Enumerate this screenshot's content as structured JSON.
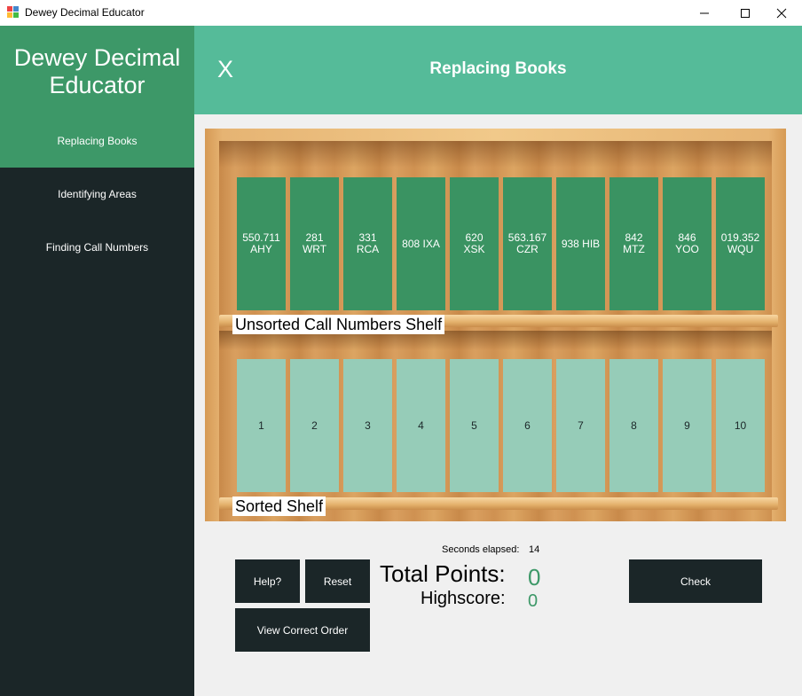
{
  "window": {
    "title": "Dewey Decimal Educator"
  },
  "sidebar": {
    "brand": "Dewey Decimal Educator",
    "items": [
      {
        "label": "Replacing Books",
        "active": true
      },
      {
        "label": "Identifying Areas",
        "active": false
      },
      {
        "label": "Finding Call Numbers",
        "active": false
      }
    ]
  },
  "header": {
    "close_label": "X",
    "title": "Replacing Books"
  },
  "unsorted_shelf": {
    "label": "Unsorted Call Numbers Shelf",
    "books": [
      {
        "number": "550.711",
        "code": "AHY"
      },
      {
        "number": "281",
        "code": "WRT"
      },
      {
        "number": "331",
        "code": "RCA"
      },
      {
        "number": "808 IXA",
        "code": ""
      },
      {
        "number": "620",
        "code": "XSK"
      },
      {
        "number": "563.167",
        "code": "CZR"
      },
      {
        "number": "938 HIB",
        "code": ""
      },
      {
        "number": "842",
        "code": "MTZ"
      },
      {
        "number": "846",
        "code": "YOO"
      },
      {
        "number": "019.352",
        "code": "WQU"
      }
    ]
  },
  "sorted_shelf": {
    "label": "Sorted Shelf",
    "slots": [
      "1",
      "2",
      "3",
      "4",
      "5",
      "6",
      "7",
      "8",
      "9",
      "10"
    ]
  },
  "stats": {
    "seconds_label": "Seconds elapsed:",
    "seconds_value": "14",
    "total_points_label": "Total Points:",
    "total_points_value": "0",
    "highscore_label": "Highscore:",
    "highscore_value": "0"
  },
  "buttons": {
    "help": "Help?",
    "reset": "Reset",
    "view_correct_order": "View Correct Order",
    "check": "Check"
  },
  "colors": {
    "sidebar_bg": "#1b2628",
    "accent_green": "#3d9868",
    "header_green": "#55bb99",
    "book_green": "#3a9362",
    "slot_green": "#96ccb8"
  }
}
